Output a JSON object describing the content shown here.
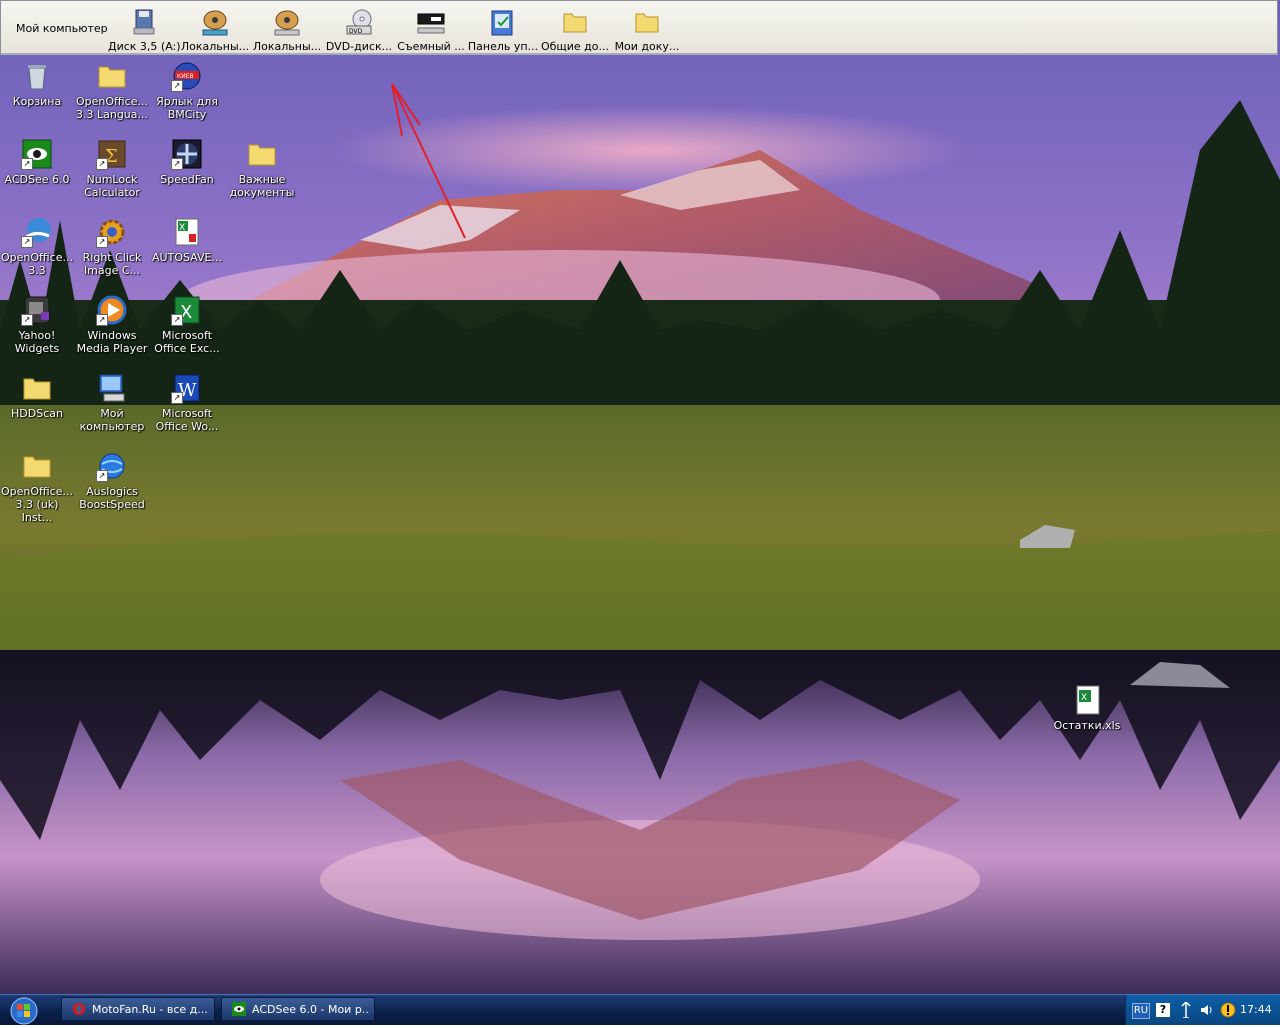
{
  "colors": {
    "toolbar_bg": "#eceae2",
    "taskbar": "#0b1f48",
    "tray": "#0d5fa8",
    "desktop_label": "#ffffff",
    "arrow": "#e0202a"
  },
  "toolbar": {
    "title": "Мой компьютер",
    "items": [
      {
        "label": "Диск 3,5 (A:)",
        "icon": "floppy-drive-icon"
      },
      {
        "label": "Локальны...",
        "icon": "hard-drive-icon"
      },
      {
        "label": "Локальны...",
        "icon": "hard-drive-icon"
      },
      {
        "label": "DVD-диск...",
        "icon": "dvd-drive-icon"
      },
      {
        "label": "Съемный ...",
        "icon": "removable-drive-icon"
      },
      {
        "label": "Панель уп...",
        "icon": "control-panel-icon"
      },
      {
        "label": "Общие до...",
        "icon": "folder-icon"
      },
      {
        "label": "Мои доку...",
        "icon": "folder-icon"
      }
    ]
  },
  "desktop": {
    "icons": [
      {
        "l1": "Корзина",
        "l2": "",
        "icon": "recycle-bin-icon"
      },
      {
        "l1": "OpenOffice...",
        "l2": "3.3 Langua...",
        "icon": "folder-icon"
      },
      {
        "l1": "Ярлык для",
        "l2": "BMCity",
        "icon": "kiev-shortcut-icon"
      },
      {
        "l1": "ACDSee 6.0",
        "l2": "",
        "icon": "acdsee-icon"
      },
      {
        "l1": "NumLock",
        "l2": "Calculator",
        "icon": "calculator-icon"
      },
      {
        "l1": "SpeedFan",
        "l2": "",
        "icon": "fan-icon"
      },
      {
        "l1": "Важные",
        "l2": "документы",
        "icon": "folder-icon"
      },
      {
        "l1": "OpenOffice...",
        "l2": "3.3",
        "icon": "openoffice-icon"
      },
      {
        "l1": "Right Click",
        "l2": "Image C...",
        "icon": "gear-icon"
      },
      {
        "l1": "AUTOSAVE...",
        "l2": "",
        "icon": "excel-file-icon"
      },
      {
        "l1": "Yahoo!",
        "l2": "Widgets",
        "icon": "widgets-icon"
      },
      {
        "l1": "Windows",
        "l2": "Media Player",
        "icon": "media-player-icon"
      },
      {
        "l1": "Microsoft",
        "l2": "Office Exc...",
        "icon": "excel-icon"
      },
      {
        "l1": "HDDScan",
        "l2": "",
        "icon": "folder-icon"
      },
      {
        "l1": "Мой",
        "l2": "компьютер",
        "icon": "computer-icon"
      },
      {
        "l1": "Microsoft",
        "l2": "Office Wo...",
        "icon": "word-icon"
      },
      {
        "l1": "OpenOffice...",
        "l2": "3.3 (uk) Inst...",
        "icon": "folder-icon"
      },
      {
        "l1": "Auslogics",
        "l2": "BoostSpeed",
        "icon": "globe-icon"
      },
      {
        "l1": "Остатки.xls",
        "l2": "",
        "icon": "excel-file-icon"
      }
    ]
  },
  "taskbar": {
    "buttons": [
      {
        "label": "MotoFan.Ru - все д...",
        "icon": "opera-icon"
      },
      {
        "label": "ACDSee 6.0 - Мои р...",
        "icon": "acdsee-icon"
      }
    ],
    "tray": {
      "lang": "RU",
      "help": "?",
      "clock": "17:44"
    }
  }
}
